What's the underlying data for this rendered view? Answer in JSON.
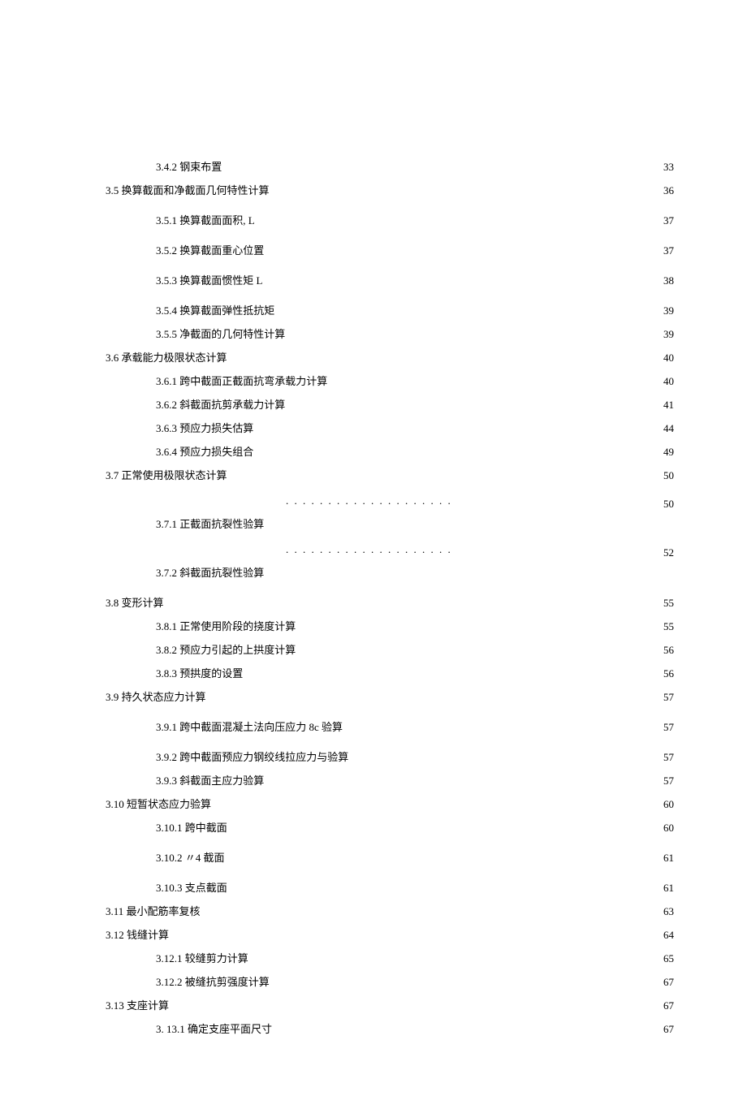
{
  "toc": [
    {
      "indent": 2,
      "label": "3.4.2 钢束布置",
      "page": "33",
      "wide": false
    },
    {
      "indent": 1,
      "label": "3.5 换算截面和净截面几何特性计算",
      "page": "36",
      "wide": true
    },
    {
      "indent": 2,
      "label": "3.5.1 换算截面面积, L",
      "page": "37",
      "wide": true
    },
    {
      "indent": 2,
      "label": "3.5.2 换算截面重心位置",
      "page": "37",
      "wide": true
    },
    {
      "indent": 2,
      "label": "3.5.3 换算截面惯性矩 L",
      "page": "38",
      "wide": true
    },
    {
      "indent": 2,
      "label": "3.5.4 换算截面弹性抵抗矩",
      "page": "39",
      "wide": false
    },
    {
      "indent": 2,
      "label": "3.5.5 净截面的几何特性计算",
      "page": "39",
      "wide": false
    },
    {
      "indent": 1,
      "label": "3.6 承载能力极限状态计算",
      "page": "40",
      "wide": false
    },
    {
      "indent": 2,
      "label": "3.6.1 跨中截面正截面抗弯承载力计算",
      "page": "40",
      "wide": false
    },
    {
      "indent": 2,
      "label": "3.6.2 斜截面抗剪承载力计算",
      "page": "41",
      "wide": false
    },
    {
      "indent": 2,
      "label": "3.6.3 预应力损失估算",
      "page": "44",
      "wide": false
    },
    {
      "indent": 2,
      "label": "3.6.4 预应力损失组合",
      "page": "49",
      "wide": false
    },
    {
      "indent": 1,
      "label": "3.7 正常使用极限状态计算",
      "page": "50",
      "wide": true
    },
    {
      "split": true,
      "label": "3.7.1 正截面抗裂性验算",
      "page": "50"
    },
    {
      "split": true,
      "label": "3.7.2 斜截面抗裂性验算",
      "page": "52"
    },
    {
      "indent": 1,
      "label": "3.8 变形计算",
      "page": "55",
      "wide": false
    },
    {
      "indent": 2,
      "label": "3.8.1 正常使用阶段的挠度计算",
      "page": "55",
      "wide": false
    },
    {
      "indent": 2,
      "label": "3.8.2 预应力引起的上拱度计算",
      "page": "56",
      "wide": false
    },
    {
      "indent": 2,
      "label": "3.8.3 预拱度的设置",
      "page": "56",
      "wide": false
    },
    {
      "indent": 1,
      "label": "3.9 持久状态应力计算",
      "page": "57",
      "wide": true
    },
    {
      "indent": 2,
      "label": "3.9.1 跨中截面混凝土法向压应力 8c 验算",
      "page": "57",
      "wide": true
    },
    {
      "indent": 2,
      "label": "3.9.2 跨中截面预应力钢绞线拉应力与验算",
      "page": "57",
      "wide": false
    },
    {
      "indent": 2,
      "label": "3.9.3 斜截面主应力验算",
      "page": "57",
      "wide": false
    },
    {
      "indent": 1,
      "label": "3.10 短暂状态应力验算",
      "page": "60",
      "wide": false
    },
    {
      "indent": 2,
      "label": "3.10.1 跨中截面",
      "page": "60",
      "wide": true
    },
    {
      "indent": 2,
      "label": "3.10.2 〃4 截面",
      "page": "61",
      "wide": true
    },
    {
      "indent": 2,
      "label": "3.10.3 支点截面",
      "page": "61",
      "wide": false
    },
    {
      "indent": 1,
      "label": "3.11 最小配筋率复核",
      "page": "63",
      "wide": false
    },
    {
      "indent": 1,
      "label": "3.12 钱缝计算",
      "page": "64",
      "wide": false
    },
    {
      "indent": 2,
      "label": "3.12.1 较缝剪力计算",
      "page": "65",
      "wide": false
    },
    {
      "indent": 2,
      "label": "3.12.2 被缝抗剪强度计算",
      "page": "67",
      "wide": false
    },
    {
      "indent": 1,
      "label": "3.13 支座计算",
      "page": "67",
      "wide": false
    },
    {
      "indent": 2,
      "label": "3.   13.1 确定支座平面尺寸",
      "page": "67",
      "wide": false
    }
  ]
}
